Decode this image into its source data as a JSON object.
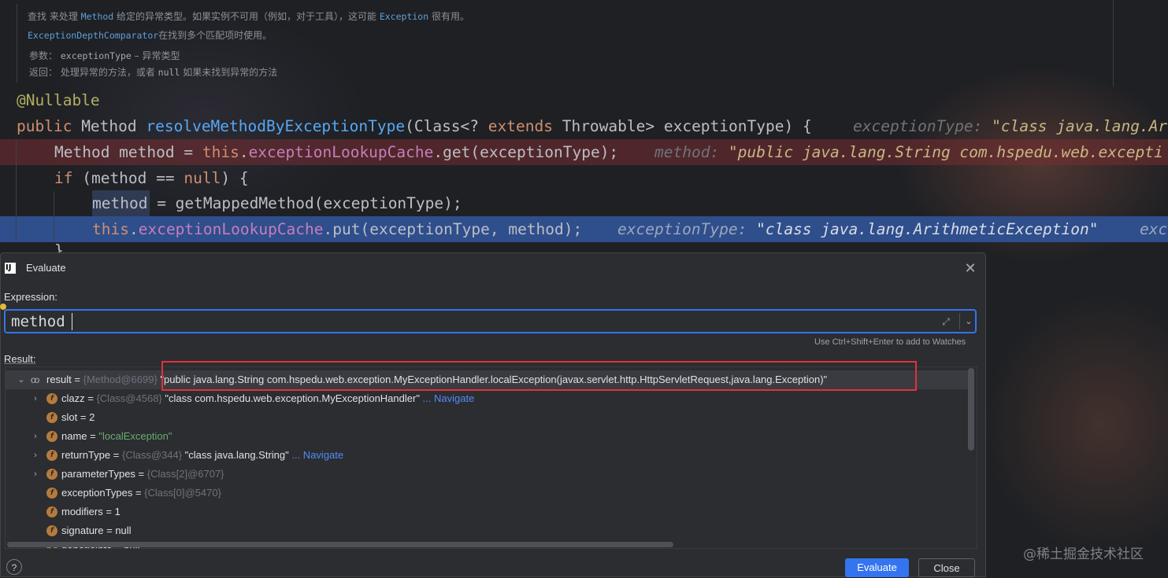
{
  "editor": {
    "doc": {
      "line1_prefix": "查找 来处理 ",
      "line1_code1": "Method",
      "line1_mid": " 给定的异常类型。如果实例不可用（例如，对于工具），这可能 ",
      "line1_code2": "Exception",
      "line1_suffix": " 很有用。",
      "line2_code": "ExceptionDepthComparator",
      "line2_suffix": "在找到多个匹配项时使用。",
      "line3_label": "参数：",
      "line3_code": "exceptionType",
      "line3_suffix": " – 异常类型",
      "line4_label": "返回：",
      "line4_prefix": "处理异常的方法，或者 ",
      "line4_code": "null",
      "line4_suffix": " 如果未找到异常的方法"
    },
    "code": {
      "annotation": "@Nullable",
      "sig_public": "public",
      "sig_type": " Method ",
      "sig_name": "resolveMethodByExceptionType",
      "sig_params_a": "(Class<? ",
      "sig_extends": "extends",
      "sig_params_b": " Throwable> exceptionType) {",
      "sig_inline_label": "exceptionType: ",
      "sig_inline_value": "\"class java.lang.Ar",
      "l1_decl": "Method method = ",
      "l1_this": "this",
      "l1_dot": ".",
      "l1_field": "exceptionLookupCache",
      "l1_call": ".get(exceptionType);",
      "l1_inline_label": "method: ",
      "l1_inline_value": "\"public java.lang.String com.hspedu.web.excepti",
      "l2_if": "if",
      "l2_open": " (method == ",
      "l2_null": "null",
      "l2_close": ") {",
      "l3_var": "method",
      "l3_rest": " = getMappedMethod(exceptionType);",
      "l4_this": "this",
      "l4_dot": ".",
      "l4_field": "exceptionLookupCache",
      "l4_call": ".put(exceptionType, method);",
      "l4_inline_label": "exceptionType: ",
      "l4_inline_value": "\"class java.lang.ArithmeticException\"",
      "l4_inline_tail": "exc",
      "l5_brace": "}"
    }
  },
  "dialog": {
    "title": "Evaluate",
    "expression_label": "Expression:",
    "expression_value": "method",
    "hint": "Use Ctrl+Shift+Enter to add to Watches",
    "result_label": "Result:",
    "result": {
      "name": "result",
      "ref": "{Method@6699}",
      "value": "\"public java.lang.String com.hspedu.web.exception.MyExceptionHandler.localException(javax.servlet.http.HttpServletRequest,java.lang.Exception)\""
    },
    "fields": [
      {
        "name": "clazz",
        "eq": " = ",
        "ref": "{Class@4568}",
        "value": " \"class com.hspedu.web.exception.MyExceptionHandler\"",
        "nav": " ... Navigate"
      },
      {
        "name": "slot",
        "eq": " = ",
        "value": "2"
      },
      {
        "name": "name",
        "eq": " = ",
        "value": "\"localException\""
      },
      {
        "name": "returnType",
        "eq": " = ",
        "ref": "{Class@344}",
        "value": " \"class java.lang.String\"",
        "nav": " ... Navigate"
      },
      {
        "name": "parameterTypes",
        "eq": " = ",
        "ref": "{Class[2]@6707}"
      },
      {
        "name": "exceptionTypes",
        "eq": " = ",
        "ref": "{Class[0]@5470}"
      },
      {
        "name": "modifiers",
        "eq": " = ",
        "value": "1"
      },
      {
        "name": "signature",
        "eq": " = ",
        "value": "null"
      },
      {
        "name": "genericInfo",
        "eq": " = ",
        "value": "null"
      }
    ],
    "field_icon_letter": "f",
    "help": "?",
    "evaluate_button": "Evaluate",
    "close_button": "Close"
  },
  "watermark": "@稀土掘金技术社区",
  "colors": {
    "accent": "#3574f0",
    "highlight_box": "#e0323a",
    "exec_line": "#2f4e8c",
    "breakpoint_line": "#782d32"
  },
  "icons": [
    "intellij-icon",
    "close-icon",
    "expand-icon",
    "chevron-down-icon",
    "bulb-icon",
    "watch-icon",
    "field-icon",
    "chevron-right-icon",
    "chevron-down-icon",
    "help-icon"
  ]
}
